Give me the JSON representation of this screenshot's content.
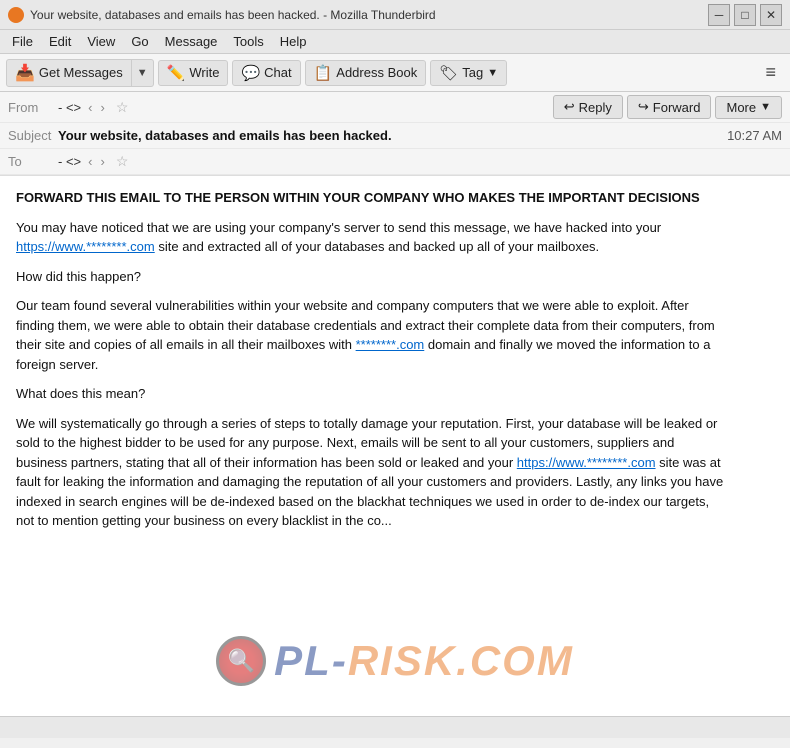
{
  "titleBar": {
    "icon": "thunderbird",
    "title": "Your website, databases and emails has been hacked. - Mozilla Thunderbird",
    "minimizeBtn": "─",
    "maximizeBtn": "□",
    "closeBtn": "✕"
  },
  "menuBar": {
    "items": [
      "File",
      "Edit",
      "View",
      "Go",
      "Message",
      "Tools",
      "Help"
    ]
  },
  "toolbar": {
    "getMessagesLabel": "Get Messages",
    "writeLabel": "Write",
    "chatLabel": "Chat",
    "addressBookLabel": "Address Book",
    "tagLabel": "Tag",
    "hamburger": "≡"
  },
  "messageHeader": {
    "fromLabel": "From",
    "fromValue": "- <>",
    "toLabel": "To",
    "toValue": "- <>",
    "subjectLabel": "Subject",
    "subjectValue": "Your website, databases and emails has been hacked.",
    "timestamp": "10:27 AM",
    "replyBtn": "Reply",
    "forwardBtn": "Forward",
    "moreBtn": "More"
  },
  "emailBody": {
    "paragraph1": "FORWARD THIS EMAIL TO THE PERSON WITHIN YOUR COMPANY WHO MAKES THE IMPORTANT DECISIONS",
    "paragraph2_before": "You may have noticed that we are using your company's server to send this message, we have hacked into your ",
    "paragraph2_link1": "https://www.********.com",
    "paragraph2_after": " site and extracted all of your databases and backed up all of your mailboxes.",
    "paragraph3": "How did this happen?",
    "paragraph4_before": "Our team found several vulnerabilities within your website and company computers that we were able to exploit. After finding them, we were able to obtain their database credentials and extract their complete data from their computers, from their site and copies of all emails in all their mailboxes with ",
    "paragraph4_link": "********.com",
    "paragraph4_after": " domain and finally we moved the information to a foreign server.",
    "paragraph5": "What does this mean?",
    "paragraph6_before": "We will systematically go through a series of steps to totally damage your reputation. First, your database will be leaked or sold to the highest bidder to be used for any purpose. Next, emails will be sent to all your customers, suppliers and business partners, stating that all of their information has been sold or leaked and your ",
    "paragraph6_link": "https://www.********.com",
    "paragraph6_after": " site was at fault for leaking the information and damaging the reputation of all your customers and providers. Lastly, any links you have indexed in search engines will be de-indexed based on the blackhat techniques we used in order to de-index our targets, not to mention getting your business on every blacklist in the co...",
    "watermarkText": "PL",
    "watermarkBrand": "RISK.COM"
  },
  "statusBar": {
    "text": ""
  }
}
